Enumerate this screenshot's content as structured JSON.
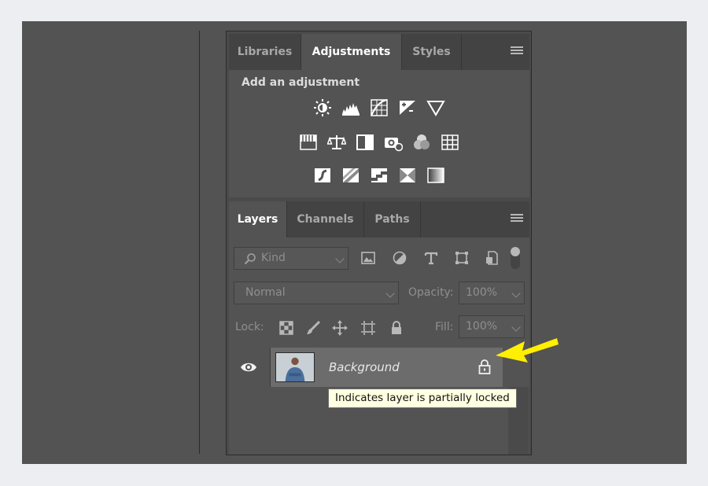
{
  "top_panel": {
    "tabs": [
      "Libraries",
      "Adjustments",
      "Styles"
    ],
    "active_tab": "Adjustments",
    "adjust_title": "Add an adjustment",
    "icon_rows": [
      [
        "brightness-contrast-icon",
        "levels-icon",
        "curves-icon",
        "exposure-icon",
        "vibrance-icon"
      ],
      [
        "hue-saturation-icon",
        "color-balance-icon",
        "black-white-icon",
        "photo-filter-icon",
        "channel-mixer-icon",
        "color-lookup-icon"
      ],
      [
        "invert-icon",
        "posterize-icon",
        "threshold-icon",
        "selective-color-icon",
        "gradient-map-icon"
      ]
    ]
  },
  "layers_panel": {
    "tabs": [
      "Layers",
      "Channels",
      "Paths"
    ],
    "active_tab": "Layers",
    "filter_kind": "Kind",
    "blend_mode": "Normal",
    "opacity_label": "Opacity:",
    "opacity_value": "100%",
    "lock_label": "Lock:",
    "fill_label": "Fill:",
    "fill_value": "100%",
    "layer_name": "Background"
  },
  "tooltip": "Indicates layer is partially locked",
  "colors": {
    "panel_bg": "#535353",
    "tab_bar": "#434343",
    "selected_layer": "#6c6c6c",
    "tooltip_bg": "#ffffe1",
    "arrow": "#ffef00"
  }
}
